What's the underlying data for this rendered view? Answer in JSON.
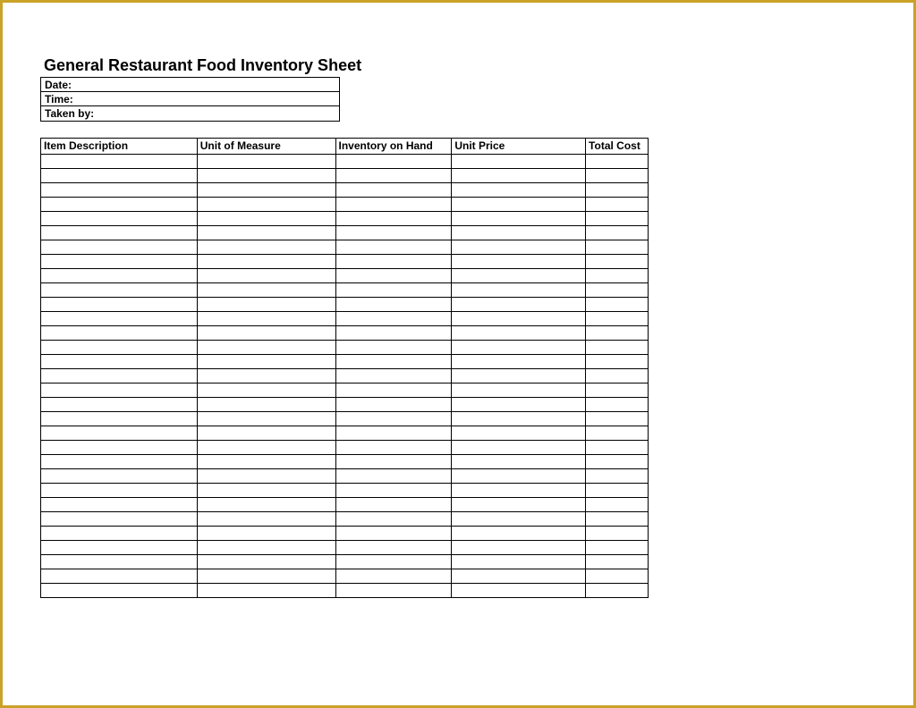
{
  "title": "General Restaurant Food Inventory Sheet",
  "meta": {
    "date_label": "Date:",
    "time_label": "Time:",
    "taken_by_label": "Taken by:"
  },
  "columns": {
    "item_description": "Item Description",
    "unit_of_measure": "Unit of Measure",
    "inventory_on_hand": "Inventory on Hand",
    "unit_price": "Unit Price",
    "total_cost": "Total Cost"
  },
  "row_count": 31
}
